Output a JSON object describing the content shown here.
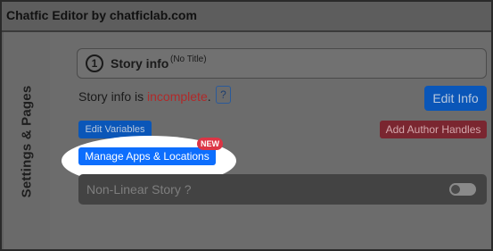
{
  "window": {
    "title": "Chatfic Editor by chatficlab.com"
  },
  "sidebar": {
    "label": "Settings & Pages"
  },
  "story_info": {
    "step_number": "1",
    "title": "Story info",
    "subtitle": "(No Title)",
    "status_prefix": "Story info is ",
    "status_value": "incomplete",
    "status_suffix": ".",
    "help_label": "?",
    "edit_info_label": "Edit Info"
  },
  "actions": {
    "edit_variables_label": "Edit Variables",
    "add_author_handles_label": "Add Author Handles",
    "manage_apps_label": "Manage Apps & Locations",
    "new_badge": "NEW"
  },
  "nonlinear": {
    "label": "Non-Linear Story ?",
    "enabled": false
  },
  "colors": {
    "primary": "#0d6efd",
    "danger": "#dc3545",
    "incomplete_text": "#b02a2a"
  }
}
